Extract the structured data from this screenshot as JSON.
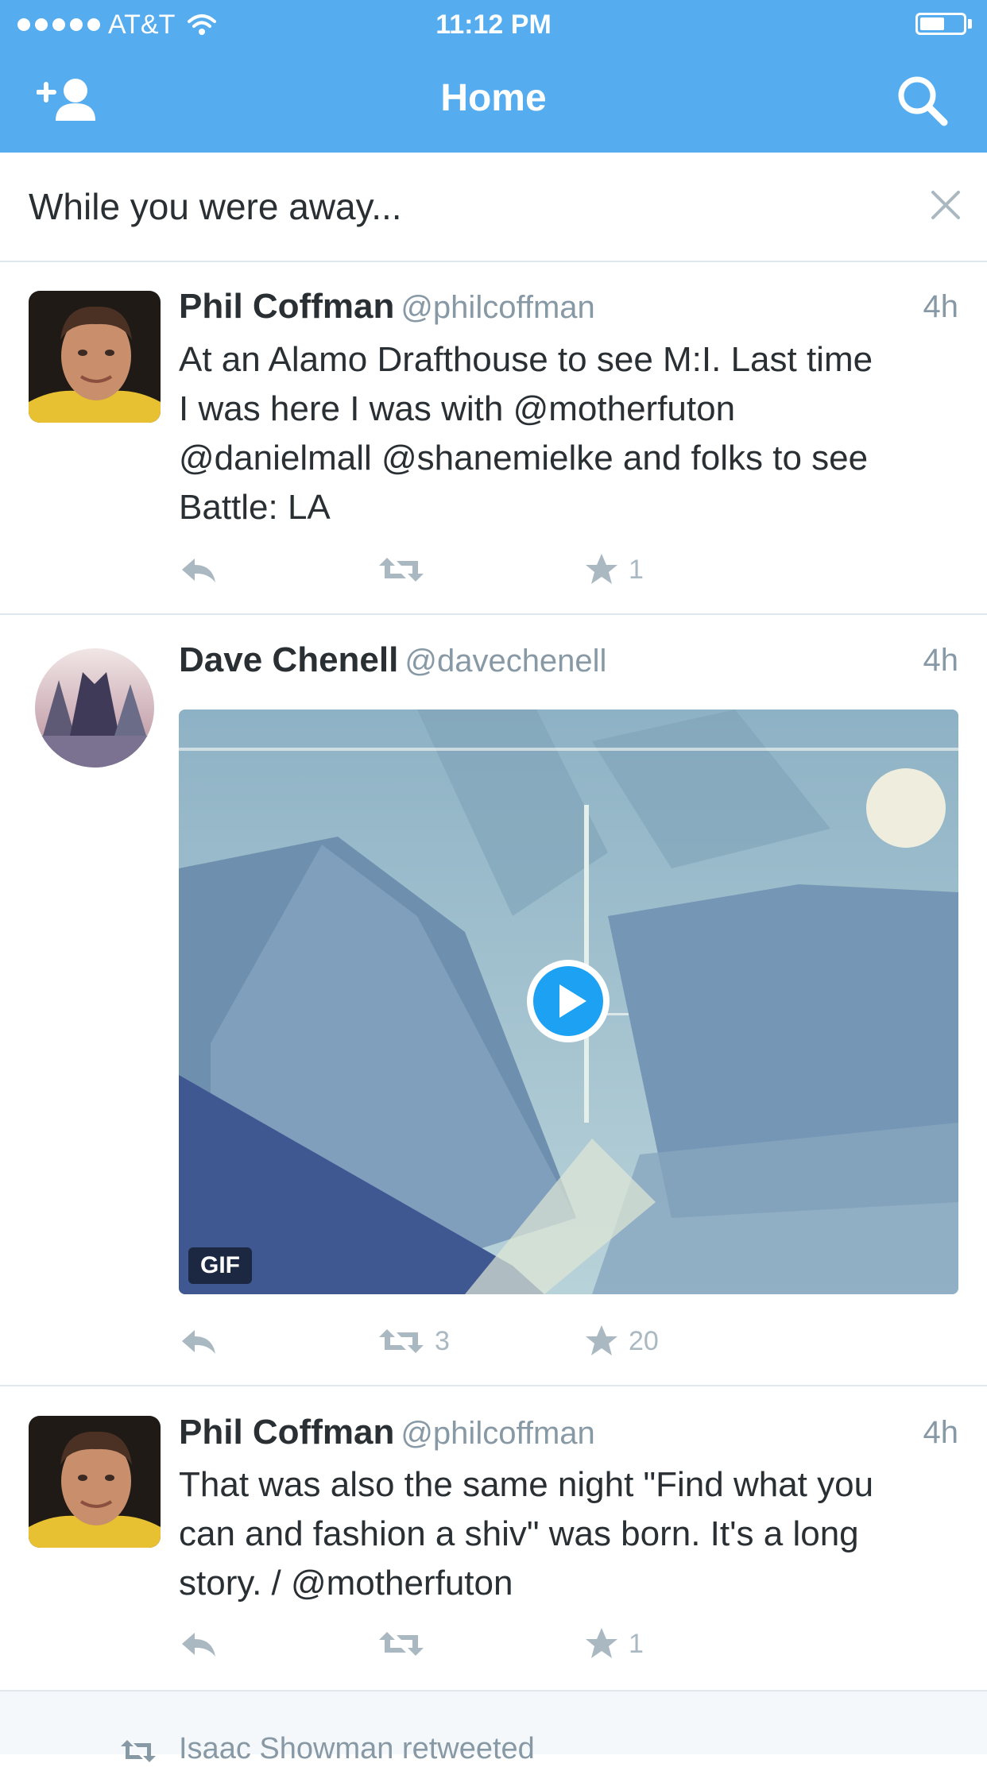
{
  "status_bar": {
    "carrier": "AT&T",
    "time": "11:12 PM",
    "signal_bars": 5,
    "battery_level": 0.45
  },
  "nav": {
    "title": "Home",
    "left_icon": "add-user-icon",
    "right_icon": "search-icon"
  },
  "away_banner": {
    "text": "While you were away...",
    "close_icon": "close-icon"
  },
  "tweets": [
    {
      "name": "Phil Coffman",
      "handle": "@philcoffman",
      "time": "4h",
      "lines": [
        "At an Alamo Drafthouse to see M:I. Last time",
        "I was here I was with @motherfuton",
        "@danielmall @shanemielke and folks to see",
        "Battle: LA"
      ],
      "retweets": "",
      "favorites": "1"
    },
    {
      "name": "Dave Chenell",
      "handle": "@davechenell",
      "time": "4h",
      "media_badge": "GIF",
      "retweets": "3",
      "favorites": "20"
    },
    {
      "name": "Phil Coffman",
      "handle": "@philcoffman",
      "time": "4h",
      "lines": [
        "That was also the same night \"Find what you",
        "can and fashion a shiv\" was born. It's a long",
        "story.  / @motherfuton"
      ],
      "retweets": "",
      "favorites": "1"
    }
  ],
  "next_context": "Isaac Showman retweeted",
  "colors": {
    "brand": "#55acee",
    "text": "#292f33",
    "muted": "#8899a6",
    "icon": "#aab8c2",
    "divider": "#e1e8ed"
  }
}
